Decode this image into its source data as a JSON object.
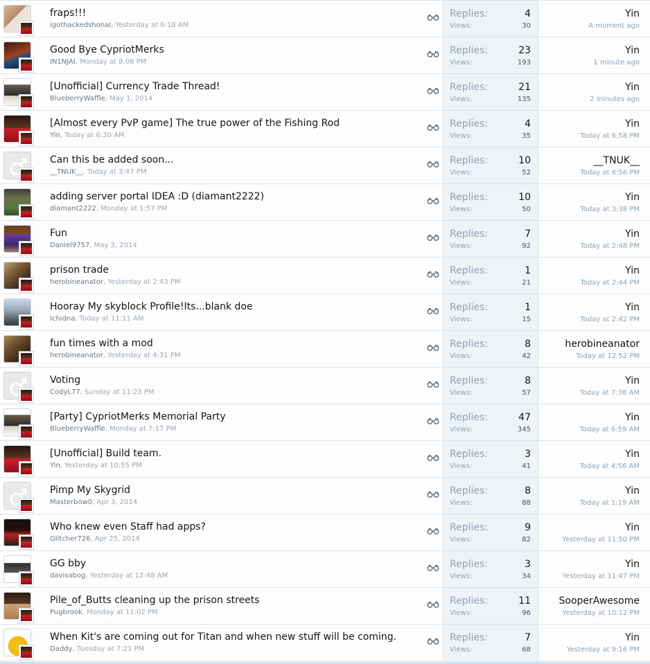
{
  "labels": {
    "replies": "Replies:",
    "views": "Views:"
  },
  "colors": {
    "row_border": "#d7e3ee",
    "stats_bg": "#eef3f8",
    "meta": "#9aa7b3"
  },
  "threads": [
    {
      "title": "fraps!!!",
      "author": "igothackedshonal",
      "started": ", Yesterday at 6:18 AM",
      "replies": "4",
      "views": "30",
      "last_user": "Yin",
      "last_time": "A moment ago",
      "avatar": "avatar-image"
    },
    {
      "title": "Good Bye CypriotMerks",
      "author": "IN1NJAI",
      "started": ", Monday at 8:08 PM",
      "replies": "23",
      "views": "193",
      "last_user": "Yin",
      "last_time": "1 minute ago",
      "avatar": "avatar-image"
    },
    {
      "title": "[Unofficial] Currency Trade Thread!",
      "author": "BlueberryWaffle",
      "started": ", May 1, 2014",
      "replies": "21",
      "views": "135",
      "last_user": "Yin",
      "last_time": "2 minutes ago",
      "avatar": "avatar-image"
    },
    {
      "title": "[Almost every PvP game] The true power of the Fishing Rod",
      "author": "Yin",
      "started": ", Today at 6:30 AM",
      "replies": "4",
      "views": "35",
      "last_user": "Yin",
      "last_time": "Today at 6:58 PM",
      "avatar": "avatar-image"
    },
    {
      "title": "Can this be added soon...",
      "author": "__TNUK__",
      "started": ", Today at 3:47 PM",
      "replies": "10",
      "views": "52",
      "last_user": "__TNUK__",
      "last_time": "Today at 6:56 PM",
      "avatar": "default-male-avatar-icon"
    },
    {
      "title": "adding server portal IDEA :D (diamant2222)",
      "author": "diamant2222",
      "started": ", Monday at 1:57 PM",
      "replies": "10",
      "views": "50",
      "last_user": "Yin",
      "last_time": "Today at 3:38 PM",
      "avatar": "avatar-image"
    },
    {
      "title": "Fun",
      "author": "Daniel9757",
      "started": ", May 3, 2014",
      "replies": "7",
      "views": "92",
      "last_user": "Yin",
      "last_time": "Today at 2:48 PM",
      "avatar": "avatar-image"
    },
    {
      "title": "prison trade",
      "author": "herobineanator",
      "started": ", Yesterday at 2:43 PM",
      "replies": "1",
      "views": "21",
      "last_user": "Yin",
      "last_time": "Today at 2:44 PM",
      "avatar": "avatar-image"
    },
    {
      "title": "Hooray My skyblock Profile!Its...blank doe",
      "author": "Ichidna",
      "started": ", Today at 11:11 AM",
      "replies": "1",
      "views": "15",
      "last_user": "Yin",
      "last_time": "Today at 2:42 PM",
      "avatar": "avatar-image"
    },
    {
      "title": "fun times with a mod",
      "author": "herobineanator",
      "started": ", Yesterday at 4:31 PM",
      "replies": "8",
      "views": "42",
      "last_user": "herobineanator",
      "last_time": "Today at 12:52 PM",
      "avatar": "avatar-image"
    },
    {
      "title": "Voting",
      "author": "CodyL77",
      "started": ", Sunday at 11:23 PM",
      "replies": "8",
      "views": "57",
      "last_user": "Yin",
      "last_time": "Today at 7:38 AM",
      "avatar": "default-male-avatar-icon"
    },
    {
      "title": "[Party] CypriotMerks Memorial Party",
      "author": "BlueberryWaffle",
      "started": ", Monday at 7:17 PM",
      "replies": "47",
      "views": "345",
      "last_user": "Yin",
      "last_time": "Today at 6:59 AM",
      "avatar": "avatar-image"
    },
    {
      "title": "[Unofficial] Build team.",
      "author": "Yin",
      "started": ", Yesterday at 10:55 PM",
      "replies": "3",
      "views": "41",
      "last_user": "Yin",
      "last_time": "Today at 4:56 AM",
      "avatar": "avatar-image"
    },
    {
      "title": "Pimp My Skygrid",
      "author": "Masterbow0",
      "started": ", Apr 3, 2014",
      "replies": "8",
      "views": "88",
      "last_user": "Yin",
      "last_time": "Today at 1:19 AM",
      "avatar": "default-male-avatar-icon"
    },
    {
      "title": "Who knew even Staff had apps?",
      "author": "Glitcher726",
      "started": ", Apr 25, 2014",
      "replies": "9",
      "views": "82",
      "last_user": "Yin",
      "last_time": "Yesterday at 11:50 PM",
      "avatar": "avatar-image"
    },
    {
      "title": "GG bby",
      "author": "davisabog",
      "started": ", Yesterday at 12:48 AM",
      "replies": "3",
      "views": "34",
      "last_user": "Yin",
      "last_time": "Yesterday at 11:47 PM",
      "avatar": "avatar-image"
    },
    {
      "title": "Pile_of_Butts cleaning up the prison streets",
      "author": "Pugbrook",
      "started": ", Monday at 11:02 PM",
      "replies": "11",
      "views": "96",
      "last_user": "SooperAwesome",
      "last_time": "Yesterday at 10:12 PM",
      "avatar": "avatar-image"
    },
    {
      "title": "When Kit's are coming out for Titan and when new stuff will be coming.",
      "author": "Daddy",
      "started": ", Tuesday at 7:21 PM",
      "replies": "7",
      "views": "68",
      "last_user": "Yin",
      "last_time": "Yesterday at 9:16 PM",
      "avatar": "avatar-image"
    }
  ]
}
